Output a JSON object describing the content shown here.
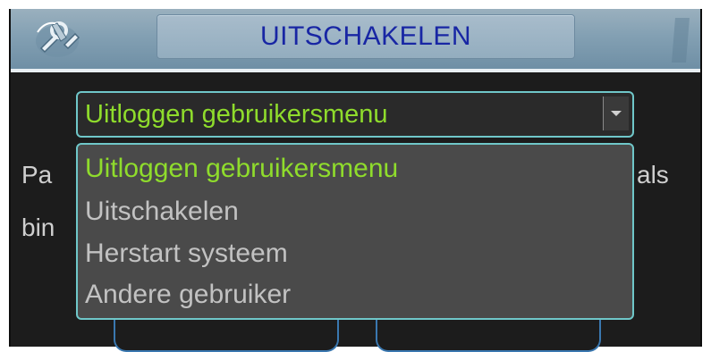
{
  "window": {
    "title": "UITSCHAKELEN"
  },
  "background_text": {
    "left_line1": "Pa",
    "left_line2": "bin",
    "right_line1": "als"
  },
  "combo": {
    "value": "Uitloggen gebruikersmenu"
  },
  "dropdown": {
    "options": [
      "Uitloggen gebruikersmenu",
      "Uitschakelen",
      "Herstart systeem",
      "Andere gebruiker"
    ],
    "selected_index": 0
  },
  "colors": {
    "selected_text": "#8fdc2c",
    "option_text": "#c2c2c2",
    "title_text": "#1826a4",
    "border": "#6fc7c9"
  },
  "icons": {
    "logo": "tools-icon",
    "dropdown": "chevron-down-icon"
  }
}
